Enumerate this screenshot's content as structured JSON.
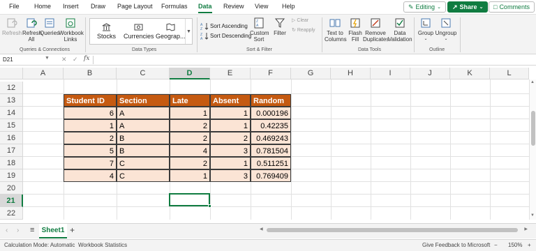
{
  "menu": {
    "items": [
      "File",
      "Home",
      "Insert",
      "Draw",
      "Page Layout",
      "Formulas",
      "Data",
      "Review",
      "View",
      "Help"
    ],
    "active": "Data",
    "editing_label": "Editing",
    "share_label": "Share",
    "comments_label": "Comments"
  },
  "ribbon": {
    "queries_group": {
      "label": "Queries & Connections",
      "buttons": [
        "Refresh",
        "Refresh All",
        "Queries",
        "Workbook Links"
      ]
    },
    "datatypes_group": {
      "label": "Data Types",
      "types": [
        "Stocks",
        "Currencies",
        "Geograp..."
      ]
    },
    "sort_group": {
      "label": "Sort & Filter",
      "sort_asc": "Sort Ascending",
      "sort_desc": "Sort Descending",
      "custom_sort": "Custom Sort",
      "filter": "Filter",
      "clear": "Clear",
      "reapply": "Reapply"
    },
    "tools_group": {
      "label": "Data Tools",
      "buttons": [
        "Text to Columns",
        "Flash Fill",
        "Remove Duplicates",
        "Data Validation"
      ]
    },
    "outline_group": {
      "label": "Outline",
      "buttons": [
        "Group",
        "Ungroup"
      ]
    }
  },
  "formula_bar": {
    "name_box": "D21",
    "fx": "fx",
    "formula": ""
  },
  "grid": {
    "columns": [
      "A",
      "B",
      "C",
      "D",
      "E",
      "F",
      "G",
      "H",
      "I",
      "J",
      "K",
      "L"
    ],
    "selected_column": "D",
    "rows": [
      "12",
      "13",
      "14",
      "15",
      "16",
      "17",
      "18",
      "19",
      "20",
      "21",
      "22"
    ],
    "selected_row": "21",
    "table": {
      "headers": [
        "Student ID",
        "Section",
        "Late",
        "Absent",
        "Random"
      ],
      "rows": [
        [
          "6",
          "A",
          "1",
          "1",
          "0.000196"
        ],
        [
          "1",
          "A",
          "2",
          "1",
          "0.42235"
        ],
        [
          "2",
          "B",
          "2",
          "2",
          "0.469243"
        ],
        [
          "5",
          "B",
          "4",
          "3",
          "0.781504"
        ],
        [
          "7",
          "C",
          "2",
          "1",
          "0.511251"
        ],
        [
          "4",
          "C",
          "1",
          "3",
          "0.769409"
        ]
      ]
    }
  },
  "sheets": {
    "tabs": [
      "Sheet1"
    ],
    "active": "Sheet1"
  },
  "status": {
    "calc_mode": "Calculation Mode: Automatic",
    "workbook_stats": "Workbook Statistics",
    "feedback": "Give Feedback to Microsoft",
    "zoom_minus": "−",
    "zoom": "150%",
    "zoom_plus": "+"
  },
  "colors": {
    "accent": "#107c41",
    "table_header": "#c55a11",
    "table_body": "#fbe4d5"
  }
}
